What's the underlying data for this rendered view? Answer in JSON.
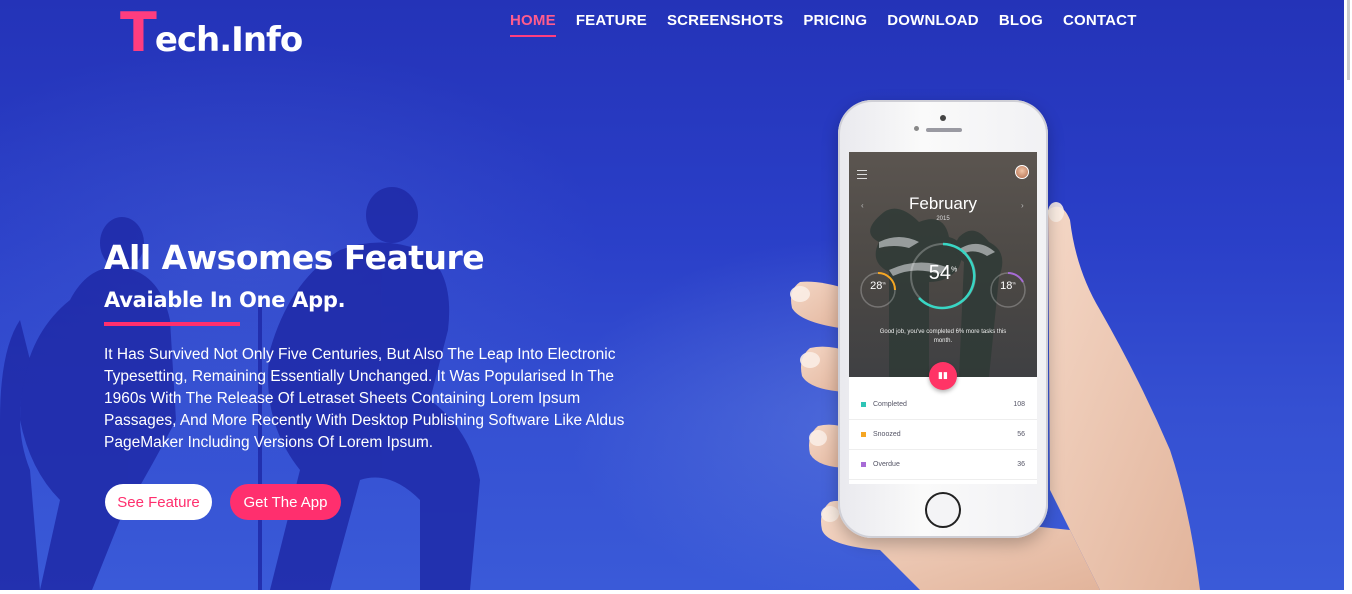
{
  "logo": {
    "first_letter": "T",
    "rest": "ech.Info"
  },
  "nav": {
    "items": [
      {
        "label": "HOME",
        "active": true
      },
      {
        "label": "FEATURE",
        "active": false
      },
      {
        "label": "SCREENSHOTS",
        "active": false
      },
      {
        "label": "PRICING",
        "active": false
      },
      {
        "label": "DOWNLOAD",
        "active": false
      },
      {
        "label": "BLOG",
        "active": false
      },
      {
        "label": "CONTACT",
        "active": false
      }
    ]
  },
  "hero": {
    "headline": "All Awsomes Feature",
    "subheadline": "Avaiable In One App.",
    "body": "It Has Survived Not Only Five Centuries, But Also The Leap Into Electronic Typesetting, Remaining Essentially Unchanged. It Was Popularised In The 1960s With The Release Of Letraset Sheets Containing Lorem Ipsum Passages, And More Recently With Desktop Publishing Software Like Aldus PageMaker Including Versions Of Lorem Ipsum.",
    "see_feature_label": "See Feature",
    "get_app_label": "Get The App"
  },
  "phone_app": {
    "month": "February",
    "year": "2015",
    "main_percent": "54",
    "left_percent": "28",
    "right_percent": "18",
    "message": "Good job, you've completed 6% more tasks this month.",
    "list": [
      {
        "label": "Completed",
        "value": "108",
        "color": "#2ec4b6"
      },
      {
        "label": "Snoozed",
        "value": "56",
        "color": "#f5a623"
      },
      {
        "label": "Overdue",
        "value": "36",
        "color": "#a76bd6"
      }
    ]
  },
  "colors": {
    "accent": "#ff2f6e",
    "hero_background": "#2a3fc8"
  }
}
